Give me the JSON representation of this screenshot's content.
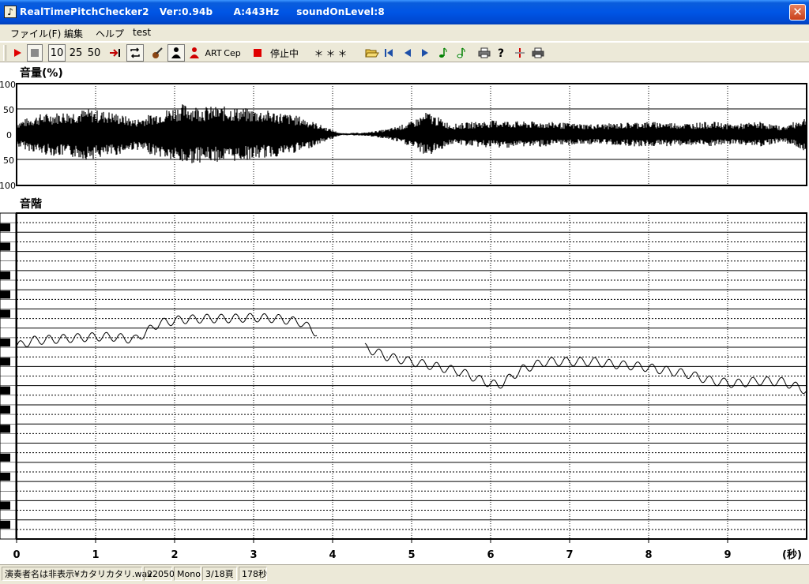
{
  "window": {
    "title": "RealTimePitchChecker2   Ver:0.94b      A:443Hz     soundOnLevel:8",
    "close_label": "✕"
  },
  "menu": [
    {
      "label": "ファイル(F)"
    },
    {
      "label": "編集"
    },
    {
      "label": "ヘルプ"
    },
    {
      "label": "test"
    }
  ],
  "toolbar": {
    "zoom_10": "10",
    "zoom_25": "25",
    "zoom_50": "50",
    "art_label": "ART",
    "cep_label": "Cep",
    "status_label": "停止中",
    "note_display": "＊＊＊"
  },
  "volume_panel": {
    "title": "音量(%)",
    "y_ticks": [
      "100",
      "50",
      "0",
      "50",
      "100"
    ]
  },
  "pitch_panel": {
    "title": "音階"
  },
  "time_axis": {
    "ticks": [
      "0",
      "1",
      "2",
      "3",
      "4",
      "5",
      "6",
      "7",
      "8",
      "9"
    ],
    "unit_label": "(秒)"
  },
  "chart_data": [
    {
      "type": "line",
      "title": "音量(%)",
      "xlabel": "(秒)",
      "ylabel": "音量(%)",
      "xlim": [
        0,
        10
      ],
      "ylim": [
        -100,
        100
      ],
      "grid": true,
      "series": [
        {
          "x": [
            0,
            0.3,
            0.6,
            0.9,
            1.2,
            1.5,
            1.8,
            2.1,
            2.4,
            2.7,
            3.0,
            3.3,
            3.6,
            3.9,
            4.1,
            4.4,
            4.7,
            5.0,
            5.2,
            5.5,
            5.8,
            6.1,
            6.4,
            6.7,
            7.0,
            7.3,
            7.6,
            7.9,
            8.2,
            8.5,
            8.8,
            9.1,
            9.4,
            9.7,
            10.0
          ],
          "values": [
            25,
            40,
            45,
            50,
            45,
            30,
            45,
            60,
            55,
            55,
            50,
            45,
            35,
            15,
            2,
            3,
            10,
            25,
            45,
            20,
            25,
            28,
            25,
            25,
            22,
            20,
            22,
            25,
            24,
            22,
            25,
            20,
            25,
            15,
            35
          ]
        }
      ]
    },
    {
      "type": "line",
      "title": "音階",
      "xlabel": "(秒)",
      "xlim": [
        0,
        10
      ],
      "series": [
        {
          "x": [
            0,
            0.2,
            0.4,
            0.6,
            0.8,
            1.0,
            1.2,
            1.5,
            1.8,
            2.1,
            2.4,
            2.7,
            3.0,
            3.3,
            3.6,
            3.8,
            4.0,
            4.4,
            4.7,
            5.0,
            5.3,
            5.6,
            5.9,
            6.1,
            6.4,
            6.7,
            7.0,
            7.3,
            7.6,
            7.9,
            8.2,
            8.5,
            8.8,
            9.1,
            9.4,
            9.7,
            10.0
          ],
          "values": [
            0.1,
            0.7,
            0.8,
            0.9,
            1.0,
            1.1,
            1.1,
            0.8,
            2.5,
            2.9,
            3.0,
            3.0,
            3.1,
            3.0,
            2.6,
            1.5,
            null,
            0.0,
            -1.0,
            -1.5,
            -2.0,
            -2.5,
            -3.5,
            -4.0,
            -2.3,
            -1.5,
            -1.5,
            -1.5,
            -1.8,
            -2.0,
            -2.4,
            -2.8,
            -3.5,
            -3.8,
            -3.5,
            -3.6,
            -4.5
          ]
        }
      ]
    }
  ]
}
